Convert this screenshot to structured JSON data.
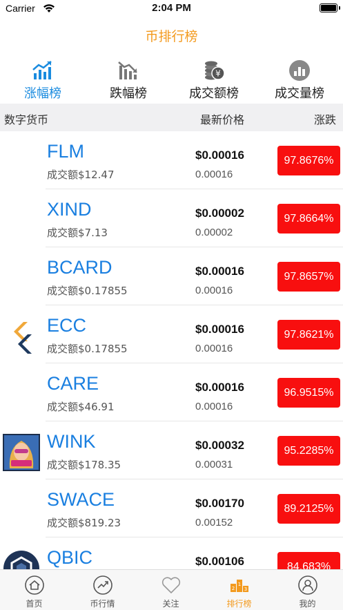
{
  "status_bar": {
    "carrier": "Carrier",
    "time": "2:04 PM"
  },
  "nav": {
    "title": "币排行榜"
  },
  "tabs": [
    {
      "label": "涨幅榜",
      "icon": "chart-up-icon",
      "active": true
    },
    {
      "label": "跌幅榜",
      "icon": "chart-down-icon",
      "active": false
    },
    {
      "label": "成交额榜",
      "icon": "coins-icon",
      "active": false
    },
    {
      "label": "成交量榜",
      "icon": "volume-icon",
      "active": false
    }
  ],
  "table_header": {
    "coin": "数字货币",
    "price": "最新价格",
    "change": "涨跌"
  },
  "rows": [
    {
      "symbol": "FLM",
      "volume": "成交额$12.47",
      "price": "$0.00016",
      "price_sub": "0.00016",
      "change": "97.8676%",
      "logo": "none"
    },
    {
      "symbol": "XIND",
      "volume": "成交额$7.13",
      "price": "$0.00002",
      "price_sub": "0.00002",
      "change": "97.8664%",
      "logo": "none"
    },
    {
      "symbol": "BCARD",
      "volume": "成交额$0.17855",
      "price": "$0.00016",
      "price_sub": "0.00016",
      "change": "97.8657%",
      "logo": "none"
    },
    {
      "symbol": "ECC",
      "volume": "成交额$0.17855",
      "price": "$0.00016",
      "price_sub": "0.00016",
      "change": "97.8621%",
      "logo": "ecc-logo-icon"
    },
    {
      "symbol": "CARE",
      "volume": "成交额$46.91",
      "price": "$0.00016",
      "price_sub": "0.00016",
      "change": "96.9515%",
      "logo": "none"
    },
    {
      "symbol": "WINK",
      "volume": "成交额$178.35",
      "price": "$0.00032",
      "price_sub": "0.00031",
      "change": "95.2285%",
      "logo": "wink-avatar-icon"
    },
    {
      "symbol": "SWACE",
      "volume": "成交额$819.23",
      "price": "$0.00170",
      "price_sub": "0.00152",
      "change": "89.2125%",
      "logo": "none"
    },
    {
      "symbol": "QBIC",
      "volume": "",
      "price": "$0.00106",
      "price_sub": "",
      "change": "84.683%",
      "logo": "qbic-logo-icon"
    }
  ],
  "bottom_bar": [
    {
      "label": "首页",
      "icon": "home-icon",
      "active": false
    },
    {
      "label": "币行情",
      "icon": "market-icon",
      "active": false
    },
    {
      "label": "关注",
      "icon": "heart-icon",
      "active": false
    },
    {
      "label": "排行榜",
      "icon": "podium-icon",
      "active": true
    },
    {
      "label": "我的",
      "icon": "user-icon",
      "active": false
    }
  ],
  "colors": {
    "accent": "#f39a1e",
    "tab_active": "#1a8bdf",
    "symbol": "#1a7fe0",
    "change_bg": "#f80f0f"
  }
}
